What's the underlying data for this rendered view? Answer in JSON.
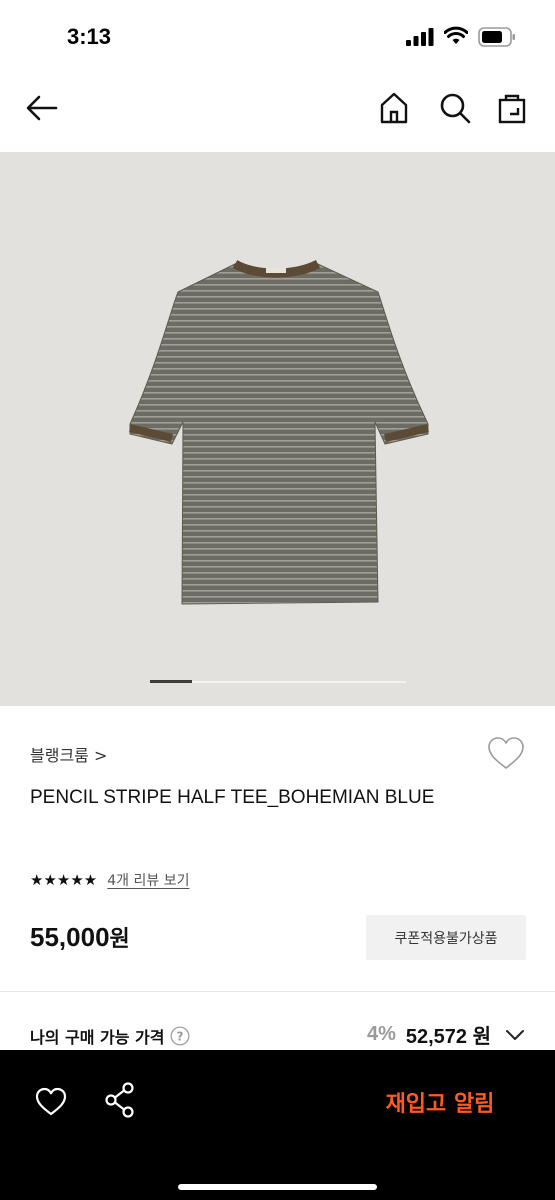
{
  "status_bar": {
    "time": "3:13"
  },
  "product": {
    "brand": "블랭크룸 >",
    "name": "PENCIL STRIPE HALF TEE_BOHEMIAN BLUE",
    "rating": 5,
    "stars": "★★★★★",
    "review_link": "4개 리뷰 보기",
    "price": "55,000",
    "price_unit": "원",
    "coupon_badge": "쿠폰적용불가상품"
  },
  "image_carousel": {
    "current": 1,
    "progress": 0.16
  },
  "my_price": {
    "label": "나의 구매 가능 가격",
    "discount": "4%",
    "price": "52,572",
    "unit": "원"
  },
  "bottom_bar": {
    "restock_label": "재입고 알림"
  },
  "icons": [
    "back-arrow-icon",
    "home-icon",
    "search-icon",
    "shopping-bag-icon",
    "heart-icon",
    "help-icon",
    "chevron-down-icon",
    "share-icon"
  ],
  "colors": {
    "accent": "#ff5a1f",
    "bottom_bar": "#000000",
    "image_bg": "#e3e1dd",
    "shirt": "#6b6a62"
  }
}
